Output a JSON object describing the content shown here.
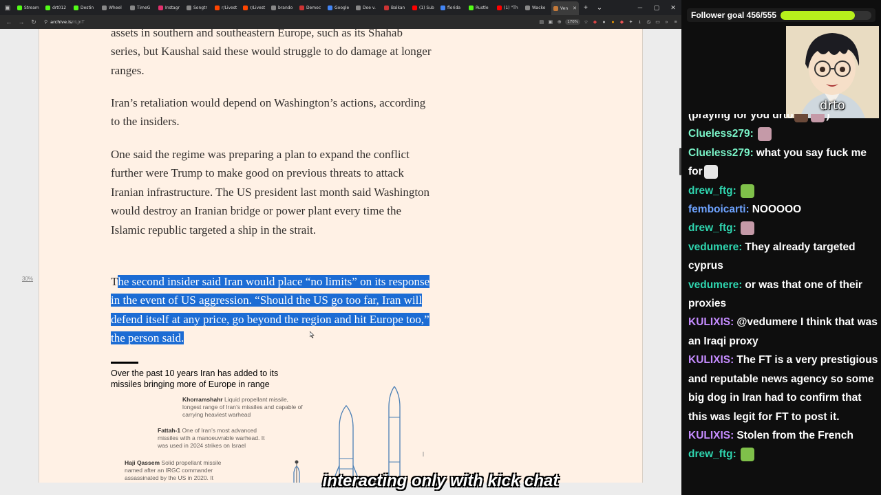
{
  "browser": {
    "tabs": [
      {
        "label": "Stream",
        "color": "#53fc18"
      },
      {
        "label": "drt012",
        "color": "#53fc18"
      },
      {
        "label": "Destin",
        "color": "#53fc18"
      },
      {
        "label": "Wheel",
        "color": "#888888"
      },
      {
        "label": "TimeG",
        "color": "#888888"
      },
      {
        "label": "Instagr",
        "color": "#e1306c"
      },
      {
        "label": "Songtr",
        "color": "#888888"
      },
      {
        "label": "r/Livest",
        "color": "#ff4500"
      },
      {
        "label": "r/Livest",
        "color": "#ff4500"
      },
      {
        "label": "brando",
        "color": "#888888"
      },
      {
        "label": "Democ",
        "color": "#cc3333"
      },
      {
        "label": "Google",
        "color": "#4285f4"
      },
      {
        "label": "Doe v.",
        "color": "#888888"
      },
      {
        "label": "Balkan",
        "color": "#cc3333"
      },
      {
        "label": "(1) Sub",
        "color": "#ff0000"
      },
      {
        "label": "florida",
        "color": "#4285f4"
      },
      {
        "label": "Rustle",
        "color": "#53fc18"
      },
      {
        "label": "(1) \"Th",
        "color": "#ff0000"
      },
      {
        "label": "Wacko",
        "color": "#888888"
      },
      {
        "label": "Ven",
        "color": "#c47a3a",
        "active": true
      }
    ],
    "url_host": "archive.is",
    "url_path": "/rLjnT",
    "zoom": "170%"
  },
  "article": {
    "p1": "assets in southern and southeastern Europe, such as its Shahab series, but Kaushal said these would struggle to do damage at longer ranges.",
    "p2": "Iran’s retaliation would depend on Washington’s actions, according to the insiders.",
    "p3": "One said the regime was preparing a plan to expand the conflict further were Trump to make good on previous threats to attack Iranian infrastructure. The US president last month said Washington would destroy an Iranian bridge or power plant every time the Islamic republic targeted a ship in the strait.",
    "p4_lead": "T",
    "p4_selected": "he second insider said Iran would place “no limits” on its response in the event of US aggression. “Should the US go too far, Iran will defend itself at any price, go beyond the region and hit Europe too,” the person said.",
    "gutter_pct": "30%",
    "figure": {
      "title": "Over the past 10 years Iran has added to its missiles bringing more of Europe in range",
      "annotations": [
        {
          "name": "Khorramshahr",
          "text": "Liquid propellant missile, longest range of Iran’s missiles and capable of carrying heaviest warhead"
        },
        {
          "name": "Fattah-1",
          "text": "One of Iran’s most advanced missiles with a manoeuvrable warhead. It was used in 2024 strikes on Israel"
        },
        {
          "name": "Haji Qassem",
          "text": "Solid propellant missile named after an IRGC commander assassinated by the US in 2020. It"
        }
      ]
    }
  },
  "stream": {
    "goal_label": "Follower goal 456/555",
    "goal_fraction": 0.82,
    "goal_color": "#b7f01c",
    "streamer_name": "drto",
    "chat": [
      {
        "user": "",
        "text": "(praying for you drto",
        "color": "#ffffff",
        "emotes": 2,
        "trail": ")"
      },
      {
        "user": "Clueless279:",
        "text": "",
        "color": "#7af4c8",
        "emotes": 1
      },
      {
        "user": "Clueless279:",
        "text": "what you say fuck me for",
        "color": "#7af4c8",
        "emotes": 1
      },
      {
        "user": "drew_ftg:",
        "text": "",
        "color": "#2fd6b0",
        "emotes": 1
      },
      {
        "user": "femboicarti:",
        "text": "NOOOOO",
        "color": "#6ea3ff",
        "emotes": 0
      },
      {
        "user": "drew_ftg:",
        "text": "",
        "color": "#2fd6b0",
        "emotes": 1
      },
      {
        "user": "vedumere:",
        "text": "They already targeted cyprus",
        "color": "#2fd6b0",
        "emotes": 0
      },
      {
        "user": "vedumere:",
        "text": "or was that one of their proxies",
        "color": "#2fd6b0",
        "emotes": 0
      },
      {
        "user": "KULIXIS:",
        "text": "@vedumere I think that was an Iraqi proxy",
        "color": "#c58cff",
        "emotes": 0
      },
      {
        "user": "KULIXIS:",
        "text": "The FT is a very prestigious and reputable news agency so some big dog in Iran had to confirm that this was legit for FT to post it.",
        "color": "#c58cff",
        "emotes": 0
      },
      {
        "user": "KULIXIS:",
        "text": "Stolen from the French",
        "color": "#c58cff",
        "emotes": 0
      },
      {
        "user": "drew_ftg:",
        "text": "",
        "color": "#2fd6b0",
        "emotes": 1
      }
    ]
  },
  "caption": "interacting only with kick chat"
}
